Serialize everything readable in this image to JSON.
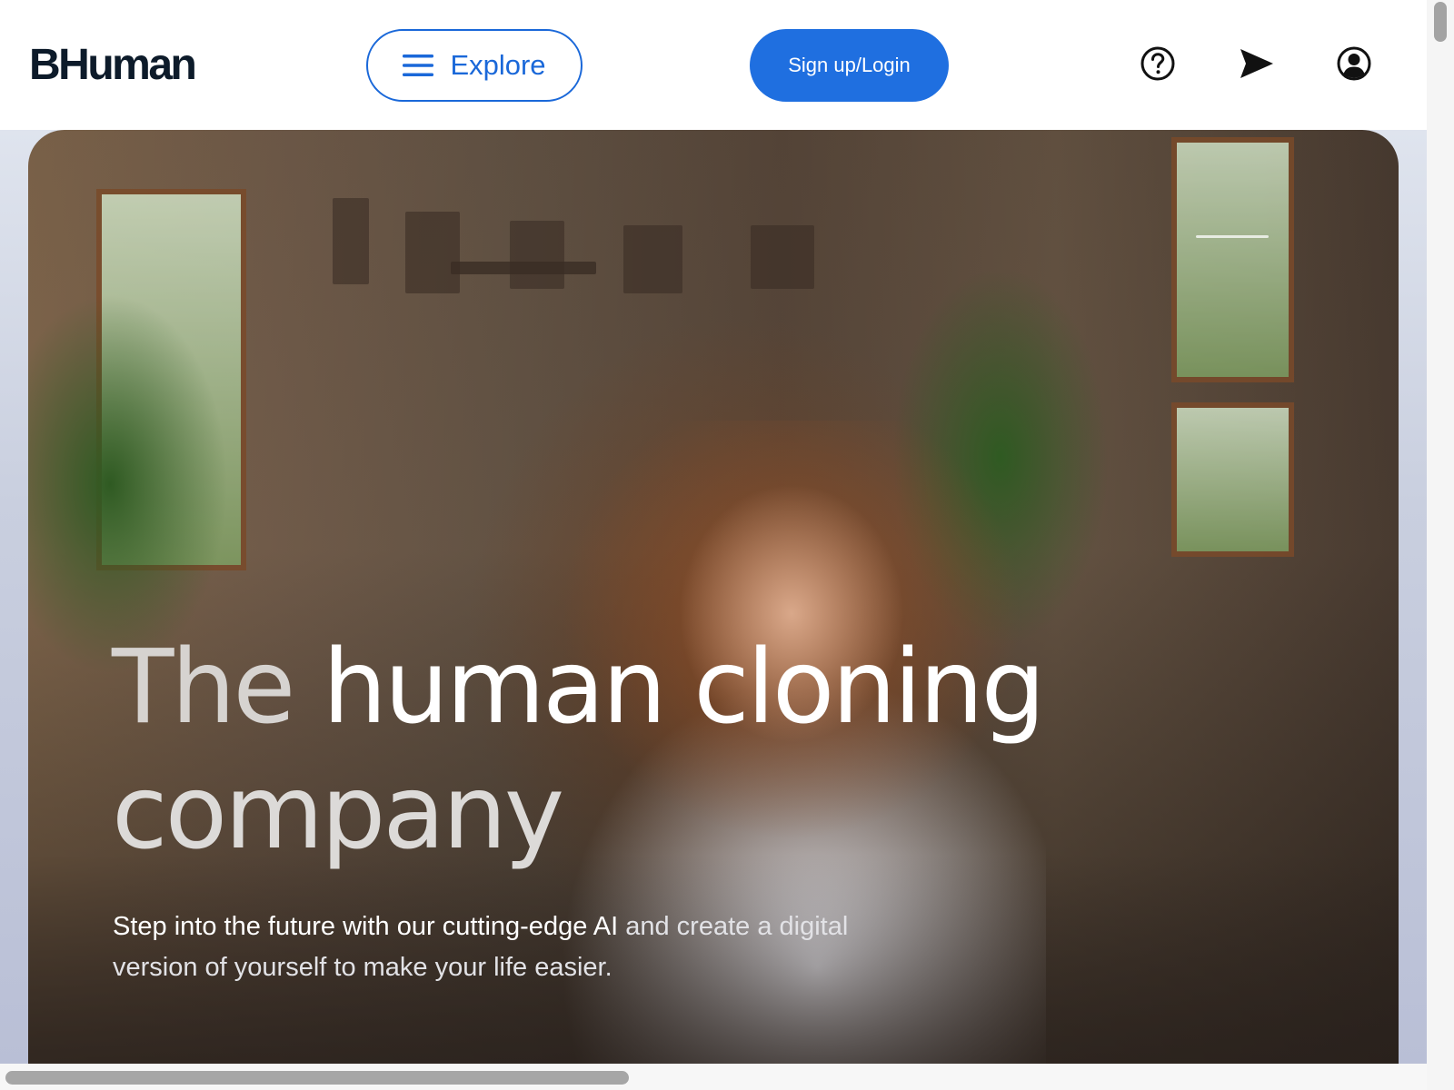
{
  "header": {
    "logo": "BHuman",
    "explore_label": "Explore",
    "signup_label": "Sign up/Login",
    "icons": [
      "help-icon",
      "send-icon",
      "account-icon"
    ],
    "accent_color": "#1f6fe0"
  },
  "hero": {
    "headline_word1": "The",
    "headline_rest": " human cloning",
    "headline_line2": "company",
    "subtitle_bright": "Step into the future with our cutting-edge AI",
    "subtitle_dim": " and create a digital version of yourself to make your life easier.",
    "background_image": "woman-waving-video-call-photo"
  }
}
